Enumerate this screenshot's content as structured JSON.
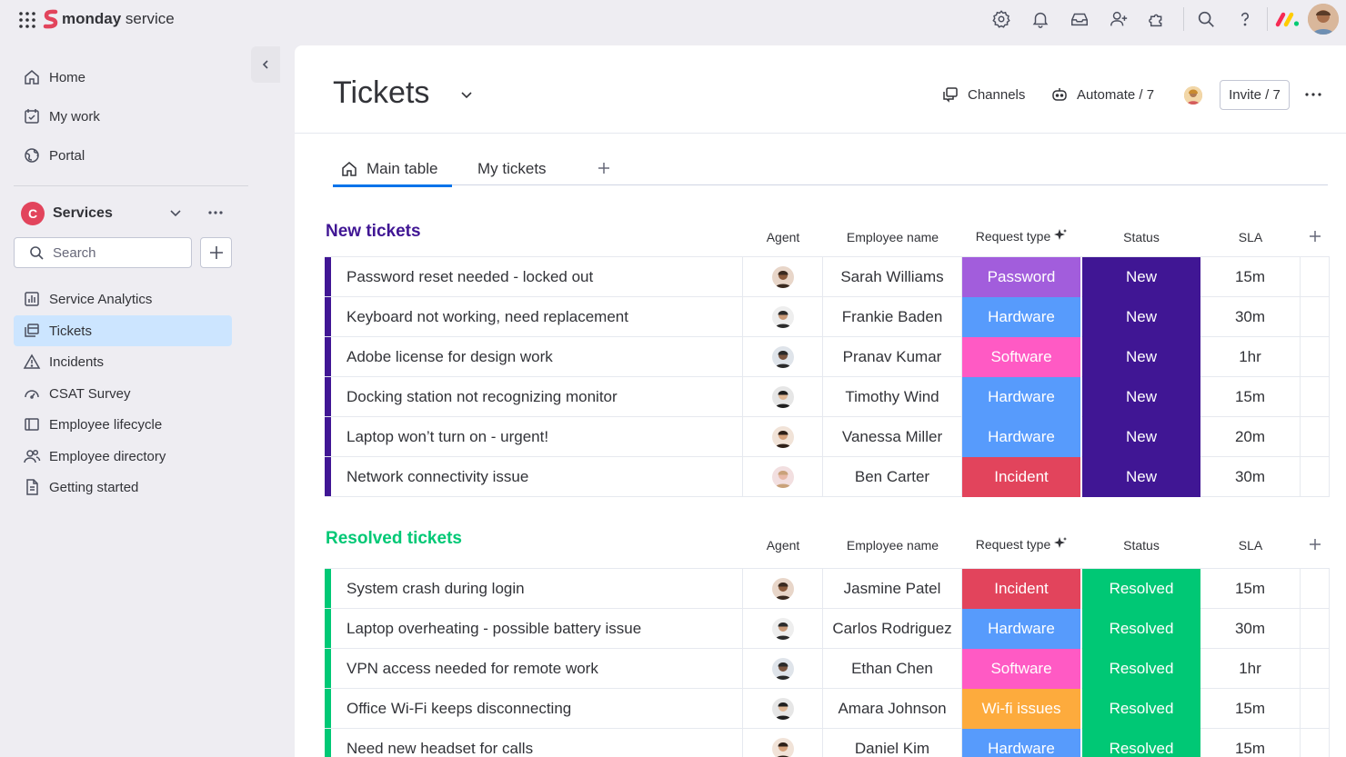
{
  "app": {
    "brand_bold": "monday",
    "brand_light": " service"
  },
  "sidebar": {
    "top_items": [
      {
        "label": "Home",
        "icon": "home-icon"
      },
      {
        "label": "My work",
        "icon": "my-work-icon"
      },
      {
        "label": "Portal",
        "icon": "portal-icon"
      }
    ],
    "workspace": {
      "initial": "C",
      "name": "Services",
      "color": "#e2445c"
    },
    "search": {
      "placeholder": "Search"
    },
    "items": [
      {
        "label": "Service Analytics",
        "icon": "chart-icon",
        "active": false
      },
      {
        "label": "Tickets",
        "icon": "board-icon",
        "active": true
      },
      {
        "label": "Incidents",
        "icon": "warning-icon",
        "active": false
      },
      {
        "label": "CSAT Survey",
        "icon": "gauge-icon",
        "active": false
      },
      {
        "label": "Employee lifecycle",
        "icon": "board-icon",
        "active": false
      },
      {
        "label": "Employee directory",
        "icon": "people-icon",
        "active": false
      },
      {
        "label": "Getting started",
        "icon": "doc-icon",
        "active": false
      }
    ]
  },
  "board": {
    "title": "Tickets",
    "channels_label": "Channels",
    "automate_label": "Automate / 7",
    "invite_label": "Invite / 7",
    "tabs": [
      {
        "label": "Main table",
        "active": true
      },
      {
        "label": "My tickets",
        "active": false
      }
    ]
  },
  "columns": {
    "agent": "Agent",
    "employee": "Employee name",
    "request": "Request type",
    "status": "Status",
    "sla": "SLA"
  },
  "colors": {
    "Password": "#a25ddc",
    "Hardware": "#579bfc",
    "Software": "#ff5ac4",
    "Incident": "#e2445c",
    "Wi-fi issues": "#fdab3d",
    "New": "#401694",
    "Resolved": "#00c875"
  },
  "groups": [
    {
      "title": "New tickets",
      "color": "#401694",
      "rows": [
        {
          "name": "Password reset needed - locked out",
          "employee": "Sarah Williams",
          "request": "Password",
          "status": "New",
          "sla": "15m"
        },
        {
          "name": "Keyboard not working, need replacement",
          "employee": "Frankie Baden",
          "request": "Hardware",
          "status": "New",
          "sla": "30m"
        },
        {
          "name": "Adobe license for design work",
          "employee": "Pranav Kumar",
          "request": "Software",
          "status": "New",
          "sla": "1hr"
        },
        {
          "name": "Docking station not recognizing monitor",
          "employee": "Timothy Wind",
          "request": "Hardware",
          "status": "New",
          "sla": "15m"
        },
        {
          "name": "Laptop won’t turn on - urgent!",
          "employee": "Vanessa Miller",
          "request": "Hardware",
          "status": "New",
          "sla": "20m"
        },
        {
          "name": "Network connectivity issue",
          "employee": "Ben Carter",
          "request": "Incident",
          "status": "New",
          "sla": "30m"
        }
      ]
    },
    {
      "title": "Resolved tickets",
      "color": "#00c875",
      "rows": [
        {
          "name": "System crash during login",
          "employee": "Jasmine Patel",
          "request": "Incident",
          "status": "Resolved",
          "sla": "15m"
        },
        {
          "name": "Laptop overheating - possible battery issue",
          "employee": "Carlos Rodriguez",
          "request": "Hardware",
          "status": "Resolved",
          "sla": "30m"
        },
        {
          "name": "VPN access needed for remote work",
          "employee": "Ethan Chen",
          "request": "Software",
          "status": "Resolved",
          "sla": "1hr"
        },
        {
          "name": "Office Wi-Fi keeps disconnecting",
          "employee": "Amara Johnson",
          "request": "Wi-fi issues",
          "status": "Resolved",
          "sla": "15m"
        },
        {
          "name": "Need new headset for calls",
          "employee": "Daniel Kim",
          "request": "Hardware",
          "status": "Resolved",
          "sla": "15m"
        }
      ]
    }
  ]
}
